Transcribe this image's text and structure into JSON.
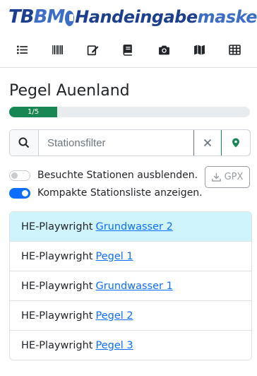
{
  "header": {
    "brand_tb": "TB",
    "brand_bm": "BM",
    "brand_hand": "Handeingabe",
    "brand_maske": "maske",
    "nav_icons": [
      "list-icon",
      "barcode-icon",
      "edit-icon",
      "book-icon",
      "camera-icon",
      "map-icon",
      "table-icon"
    ]
  },
  "page": {
    "title": "Pegel Auenland",
    "progress_label": "1/5",
    "progress_fraction": 0.2
  },
  "search": {
    "placeholder": "Stationsfilter",
    "value": ""
  },
  "options": {
    "hide_visited_label": "Besuchte Stationen ausblenden.",
    "hide_visited": false,
    "compact_list_label": "Kompakte Stationsliste anzeigen.",
    "compact_list": true,
    "gpx_label": "GPX"
  },
  "stations": [
    {
      "prefix": "HE-Playwright",
      "name": "Grundwasser 2",
      "active": true
    },
    {
      "prefix": "HE-Playwright",
      "name": "Pegel 1",
      "active": false
    },
    {
      "prefix": "HE-Playwright",
      "name": "Grundwasser 1",
      "active": false
    },
    {
      "prefix": "HE-Playwright",
      "name": "Pegel 2",
      "active": false
    },
    {
      "prefix": "HE-Playwright",
      "name": "Pegel 3",
      "active": false
    }
  ],
  "colors": {
    "brand_dark": "#1d3f8f",
    "brand_light": "#3d6ec7",
    "progress": "#198754",
    "active_row": "#cff4fc",
    "link": "#0d6efd",
    "switch_on": "#0d6efd"
  }
}
